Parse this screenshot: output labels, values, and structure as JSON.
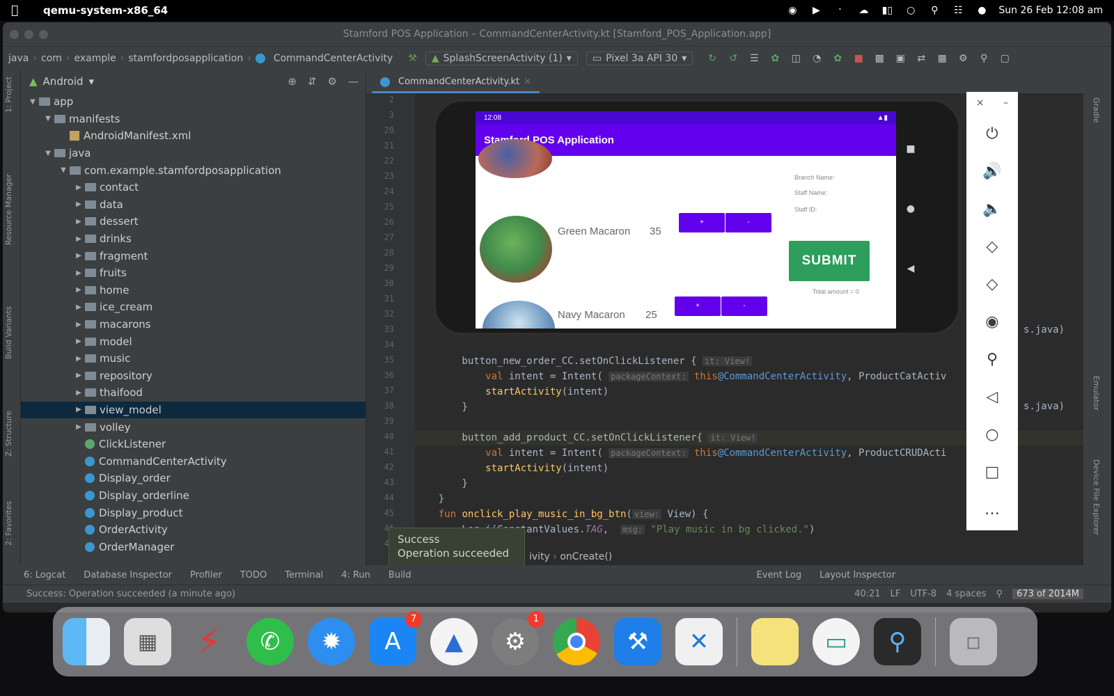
{
  "menubar": {
    "app": "qemu-system-x86_64",
    "datetime": "Sun 26 Feb 12:08 am"
  },
  "window": {
    "title": "Stamford POS Application – CommandCenterActivity.kt [Stamford_POS_Application.app]"
  },
  "nav": {
    "crumbs": [
      "java",
      "com",
      "example",
      "stamfordposapplication",
      "CommandCenterActivity"
    ],
    "run_config": "SplashScreenActivity (1)",
    "device": "Pixel 3a API 30"
  },
  "left_tabs": [
    "1: Project",
    "Resource Manager",
    "Build Variants",
    "Z: Structure",
    "2: Favorites"
  ],
  "project": {
    "view": "Android",
    "tree": [
      {
        "label": "app",
        "depth": 0,
        "kind": "folder",
        "arrow": "▼"
      },
      {
        "label": "manifests",
        "depth": 1,
        "kind": "folder",
        "arrow": "▼"
      },
      {
        "label": "AndroidManifest.xml",
        "depth": 2,
        "kind": "xml",
        "arrow": ""
      },
      {
        "label": "java",
        "depth": 1,
        "kind": "folder",
        "arrow": "▼"
      },
      {
        "label": "com.example.stamfordposapplication",
        "depth": 2,
        "kind": "folder",
        "arrow": "▼"
      },
      {
        "label": "contact",
        "depth": 3,
        "kind": "folder",
        "arrow": "▶"
      },
      {
        "label": "data",
        "depth": 3,
        "kind": "folder",
        "arrow": "▶"
      },
      {
        "label": "dessert",
        "depth": 3,
        "kind": "folder",
        "arrow": "▶"
      },
      {
        "label": "drinks",
        "depth": 3,
        "kind": "folder",
        "arrow": "▶"
      },
      {
        "label": "fragment",
        "depth": 3,
        "kind": "folder",
        "arrow": "▶"
      },
      {
        "label": "fruits",
        "depth": 3,
        "kind": "folder",
        "arrow": "▶"
      },
      {
        "label": "home",
        "depth": 3,
        "kind": "folder",
        "arrow": "▶"
      },
      {
        "label": "ice_cream",
        "depth": 3,
        "kind": "folder",
        "arrow": "▶"
      },
      {
        "label": "macarons",
        "depth": 3,
        "kind": "folder",
        "arrow": "▶"
      },
      {
        "label": "model",
        "depth": 3,
        "kind": "folder",
        "arrow": "▶"
      },
      {
        "label": "music",
        "depth": 3,
        "kind": "folder",
        "arrow": "▶"
      },
      {
        "label": "repository",
        "depth": 3,
        "kind": "folder",
        "arrow": "▶"
      },
      {
        "label": "thaifood",
        "depth": 3,
        "kind": "folder",
        "arrow": "▶"
      },
      {
        "label": "view_model",
        "depth": 3,
        "kind": "folder",
        "arrow": "▶",
        "selected": true
      },
      {
        "label": "volley",
        "depth": 3,
        "kind": "folder",
        "arrow": "▶"
      },
      {
        "label": "ClickListener",
        "depth": 3,
        "kind": "iface",
        "arrow": ""
      },
      {
        "label": "CommandCenterActivity",
        "depth": 3,
        "kind": "class",
        "arrow": ""
      },
      {
        "label": "Display_order",
        "depth": 3,
        "kind": "class",
        "arrow": ""
      },
      {
        "label": "Display_orderline",
        "depth": 3,
        "kind": "class",
        "arrow": ""
      },
      {
        "label": "Display_product",
        "depth": 3,
        "kind": "class",
        "arrow": ""
      },
      {
        "label": "OrderActivity",
        "depth": 3,
        "kind": "class",
        "arrow": ""
      },
      {
        "label": "OrderManager",
        "depth": 3,
        "kind": "class",
        "arrow": ""
      }
    ]
  },
  "editor": {
    "tab": "CommandCenterActivity.kt",
    "line_numbers": [
      "2",
      "3",
      "20",
      "21",
      "22",
      "23",
      "24",
      "25",
      "26",
      "27",
      "28",
      "29",
      "30",
      "31",
      "32",
      "33",
      "34",
      "35",
      "36",
      "37",
      "38",
      "39",
      "40",
      "41",
      "42",
      "43",
      "44",
      "45",
      "46",
      "47"
    ],
    "code": [
      {
        "n": "35",
        "parts": [
          [
            "p",
            "        button_new_order_CC.setOnClickListener { "
          ],
          [
            "h",
            "it: View!"
          ]
        ]
      },
      {
        "n": "36",
        "parts": [
          [
            "p",
            "            "
          ],
          [
            "k",
            "val"
          ],
          [
            "p",
            " intent = Intent( "
          ],
          [
            "h",
            "packageContext:"
          ],
          [
            "k",
            " this"
          ],
          [
            "a",
            "@CommandCenterActivity"
          ],
          [
            "p",
            ", ProductCatActiv"
          ]
        ]
      },
      {
        "n": "37",
        "parts": [
          [
            "p",
            "            "
          ],
          [
            "f",
            "startActivity"
          ],
          [
            "p",
            "(intent)"
          ]
        ]
      },
      {
        "n": "38",
        "parts": [
          [
            "p",
            "        }"
          ]
        ]
      },
      {
        "n": "39",
        "parts": [
          [
            "p",
            ""
          ]
        ]
      },
      {
        "n": "40",
        "parts": [
          [
            "p",
            "        button_add_product_CC.setOnClickListener{ "
          ],
          [
            "h",
            "it: View!"
          ]
        ]
      },
      {
        "n": "41",
        "parts": [
          [
            "p",
            "            "
          ],
          [
            "k",
            "val"
          ],
          [
            "p",
            " intent = Intent( "
          ],
          [
            "h",
            "packageContext:"
          ],
          [
            "k",
            " this"
          ],
          [
            "a",
            "@CommandCenterActivity"
          ],
          [
            "p",
            ", ProductCRUDActi"
          ]
        ]
      },
      {
        "n": "42",
        "parts": [
          [
            "p",
            "            "
          ],
          [
            "f",
            "startActivity"
          ],
          [
            "p",
            "(intent)"
          ]
        ]
      },
      {
        "n": "43",
        "parts": [
          [
            "p",
            "        }"
          ]
        ]
      },
      {
        "n": "44",
        "parts": [
          [
            "p",
            "    }"
          ]
        ]
      },
      {
        "n": "45",
        "parts": [
          [
            "k",
            "    fun "
          ],
          [
            "f",
            "onclick_play_music_in_bg_btn"
          ],
          [
            "p",
            "("
          ],
          [
            "h",
            "view:"
          ],
          [
            "p",
            " View) {"
          ]
        ]
      },
      {
        "n": "46",
        "parts": [
          [
            "p",
            "        Log.i(ConstantValues."
          ],
          [
            "t",
            "TAG"
          ],
          [
            "p",
            ",  "
          ],
          [
            "h",
            "msg:"
          ],
          [
            "s",
            " \"Play music in bg clicked.\""
          ],
          [
            "p",
            ")"
          ]
        ]
      }
    ],
    "tail_java": [
      "s.java)",
      "s.java)"
    ],
    "crumb": [
      "ivity",
      "onCreate()"
    ]
  },
  "phone": {
    "time": "12:08",
    "app_title": "Stamford POS Application",
    "products": [
      {
        "name": "Green Macaron",
        "qty": "35"
      },
      {
        "name": "Navy Macaron",
        "qty": "25"
      }
    ],
    "btn_plus": "+",
    "btn_minus": "-",
    "labels": {
      "branch": "Branch Name:",
      "staff": "Staff Name:",
      "id": "Staff ID:"
    },
    "submit": "SUBMIT",
    "total": "Total amount = 0"
  },
  "emulator": {
    "icons": [
      "power-icon",
      "volume-up-icon",
      "volume-down-icon",
      "rotate-left-icon",
      "rotate-right-icon",
      "camera-icon",
      "zoom-icon",
      "back-icon",
      "home-icon",
      "overview-icon",
      "more-icon"
    ]
  },
  "right_tabs": [
    "Gradle",
    "Emulator",
    "Device File Explorer"
  ],
  "toast": {
    "title": "Success",
    "message": "Operation succeeded"
  },
  "tool_windows": [
    "6: Logcat",
    "Database Inspector",
    "Profiler",
    "TODO",
    "Terminal",
    "4: Run",
    "Build",
    "Event Log",
    "Layout Inspector"
  ],
  "status": {
    "message": "Success: Operation succeeded (a minute ago)",
    "pos": "40:21",
    "lf": "LF",
    "enc": "UTF-8",
    "indent": "4 spaces",
    "mem": "673 of 2014M"
  },
  "dock": {
    "badges": {
      "appstore": "7",
      "settings": "1"
    }
  },
  "colors": {
    "accent": "#6200ee",
    "submit": "#2e9e5c",
    "selection": "#0d293e"
  }
}
